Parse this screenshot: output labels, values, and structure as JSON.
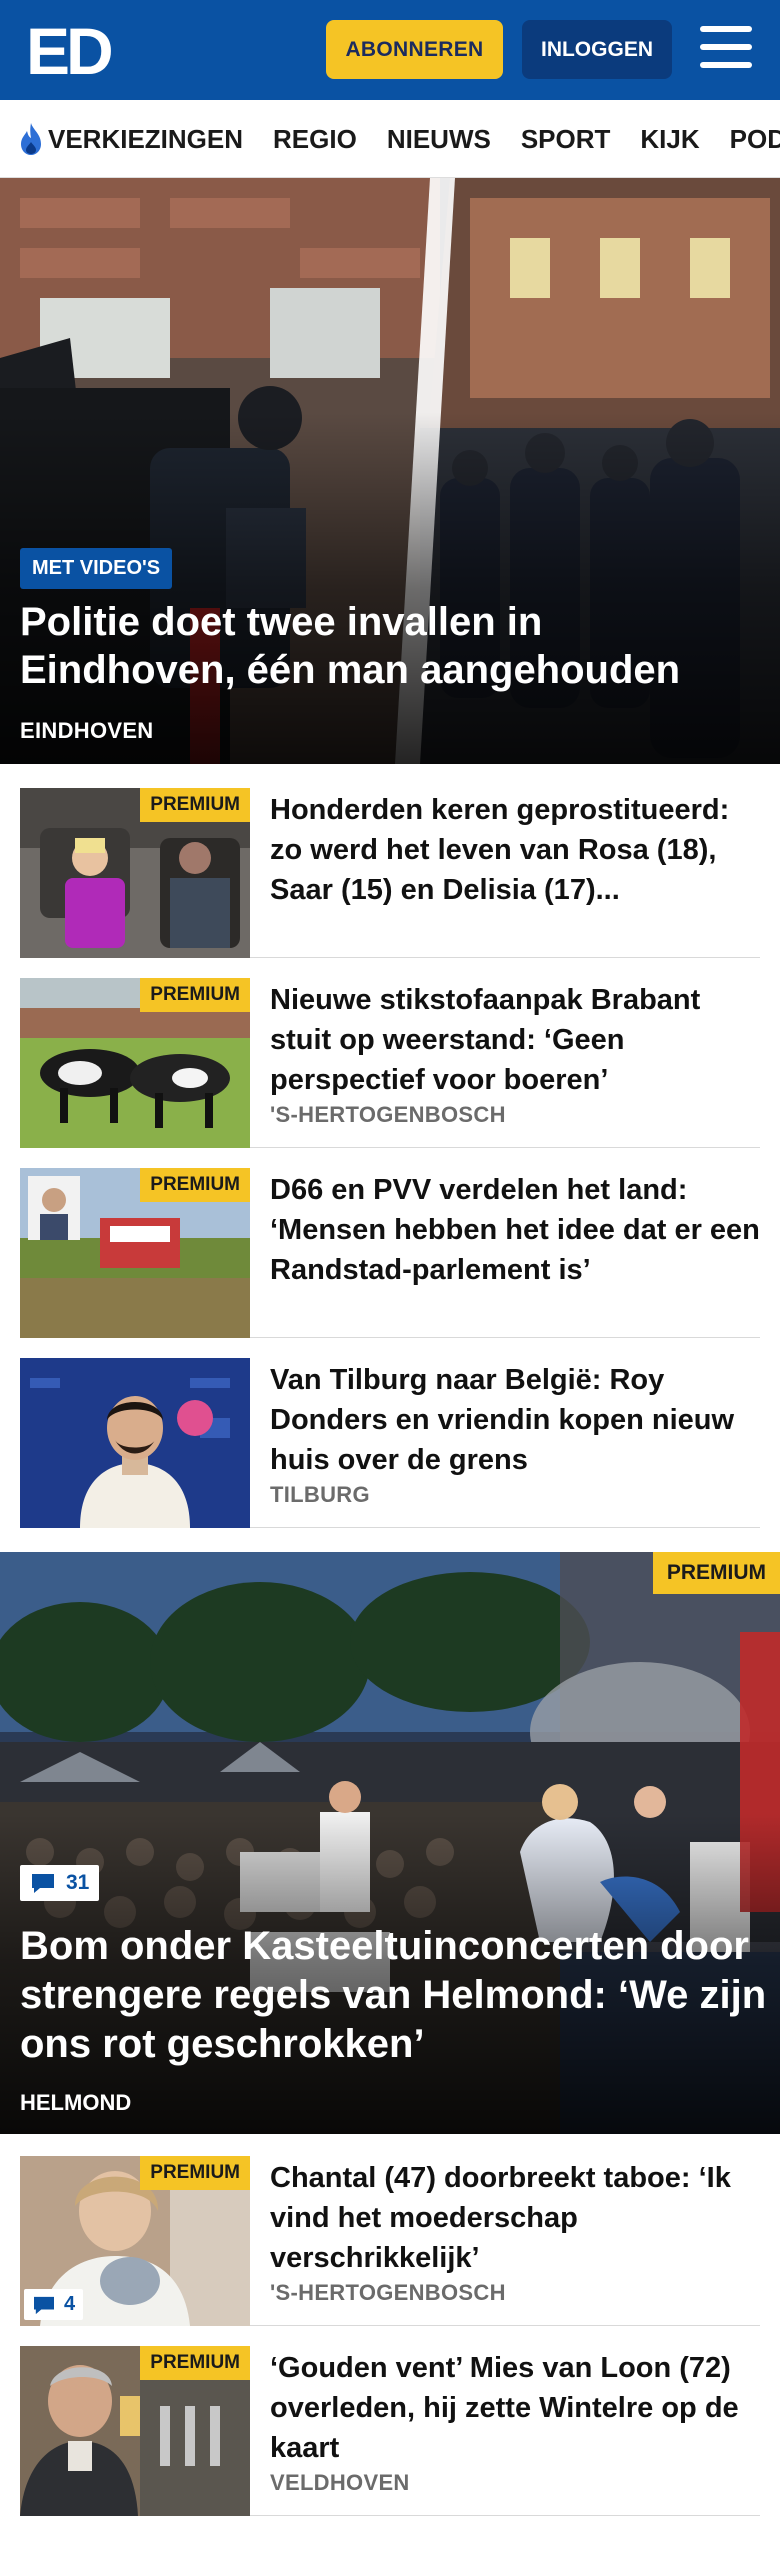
{
  "header": {
    "logo_text": "ED",
    "subscribe_label": "ABONNEREN",
    "login_label": "INLOGGEN",
    "brand_color": "#0a52a3",
    "accent_color": "#f5c425"
  },
  "nav": {
    "items": [
      {
        "label": "VERKIEZINGEN",
        "icon": "flame-icon"
      },
      {
        "label": "REGIO"
      },
      {
        "label": "NIEUWS"
      },
      {
        "label": "SPORT"
      },
      {
        "label": "KIJK"
      },
      {
        "label": "PODCAST"
      }
    ]
  },
  "hero": {
    "badge": "MET VIDEO'S",
    "title": "Politie doet twee invallen in Eindhoven, één man aangehouden",
    "place": "EINDHOVEN"
  },
  "articles_1": [
    {
      "premium": "PREMIUM",
      "title": "Honderden keren geprostitueerd: zo werd het leven van Rosa (18), Saar (15) en Delisia (17)...",
      "place": ""
    },
    {
      "premium": "PREMIUM",
      "title": "Nieuwe stikstofaanpak Brabant stuit op weerstand: ‘Geen perspectief voor boeren’",
      "place": "'S-HERTOGENBOSCH"
    },
    {
      "premium": "PREMIUM",
      "title": "D66 en PVV verdelen het land: ‘Mensen hebben het idee dat er een Randstad-parlement is’",
      "place": ""
    },
    {
      "premium": "",
      "title": "Van Tilburg naar België: Roy Donders en vriendin kopen nieuw huis over de grens",
      "place": "TILBURG"
    }
  ],
  "hero2": {
    "premium": "PREMIUM",
    "comments": "31",
    "title": "Bom onder Kasteeltuinconcerten door strengere regels van Helmond: ‘We zijn ons rot geschrokken’",
    "place": "HELMOND"
  },
  "articles_2": [
    {
      "premium": "PREMIUM",
      "comments": "4",
      "title": "Chantal (47) doorbreekt taboe: ‘Ik vind het moederschap verschrikkelijk’",
      "place": "'S-HERTOGENBOSCH"
    },
    {
      "premium": "PREMIUM",
      "title": "‘Gouden vent’ Mies van Loon (72) overleden, hij zette Wintelre op de kaart",
      "place": "VELDHOVEN"
    }
  ]
}
